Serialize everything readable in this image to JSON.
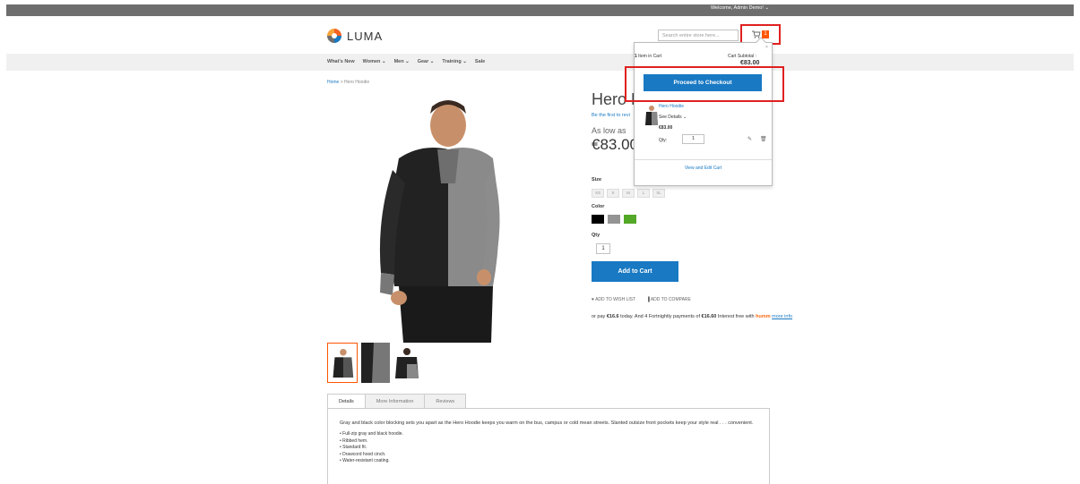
{
  "header": {
    "welcome": "Welcome, Admin Demo! ⌄",
    "logo_text": "LUMA",
    "search_placeholder": "Search entire store here...",
    "cart_count": "1"
  },
  "nav": {
    "items": [
      "What's New",
      "Women ⌄",
      "Men ⌄",
      "Gear ⌄",
      "Training ⌄",
      "Sale"
    ]
  },
  "breadcrumb": {
    "home": "Home",
    "separator": ">",
    "current": "Hero Hoodie"
  },
  "product": {
    "title": "Hero H",
    "review_link": "Be the first to revi",
    "as_low_as": "As low as",
    "price": "€83.00",
    "size_label": "Size",
    "sizes": [
      "XS",
      "S",
      "M",
      "L",
      "XL"
    ],
    "color_label": "Color",
    "colors": [
      "#000000",
      "#949494",
      "#53a828"
    ],
    "qty_label": "Qty",
    "qty_value": "1",
    "add_to_cart": "Add to Cart",
    "wish_list": "♥ ADD TO WISH LIST",
    "compare": "▐ ADD TO COMPARE",
    "humm_text_1": "or pay",
    "humm_amount_1": "€16.6",
    "humm_text_2": "today. And 4 Fortnightly payments of",
    "humm_amount_2": "€16.60",
    "humm_text_3": "Interest free with",
    "humm_logo": "humm",
    "humm_more": "more info"
  },
  "tabs": {
    "items": [
      "Details",
      "More Information",
      "Reviews"
    ],
    "description": "Gray and black color blocking sets you apart as the Hero Hoodie keeps you warm on the bus, campus or cold mean streets. Slanted outsize front pockets keep your style real . . . convenient.",
    "features": [
      "Full-zip gray and black hoodie.",
      "Ribbed hem.",
      "Standard fit.",
      "Drawcord hood cinch.",
      "Water-resistant coating."
    ]
  },
  "minicart": {
    "close": "×",
    "item_count": "1",
    "item_count_label": "Item in Cart",
    "subtotal_label": "Cart Subtotal :",
    "subtotal": "€83.00",
    "checkout": "Proceed to Checkout",
    "item_name": "Hero Hoodie",
    "see_details": "See Details ⌄",
    "item_price": "€83.00",
    "qty_label": "Qty:",
    "qty_value": "1",
    "view_edit": "View and Edit Cart"
  },
  "colors": {
    "accent": "#1979c3",
    "brand_orange": "#ff5501",
    "highlight_red": "#e02020"
  }
}
